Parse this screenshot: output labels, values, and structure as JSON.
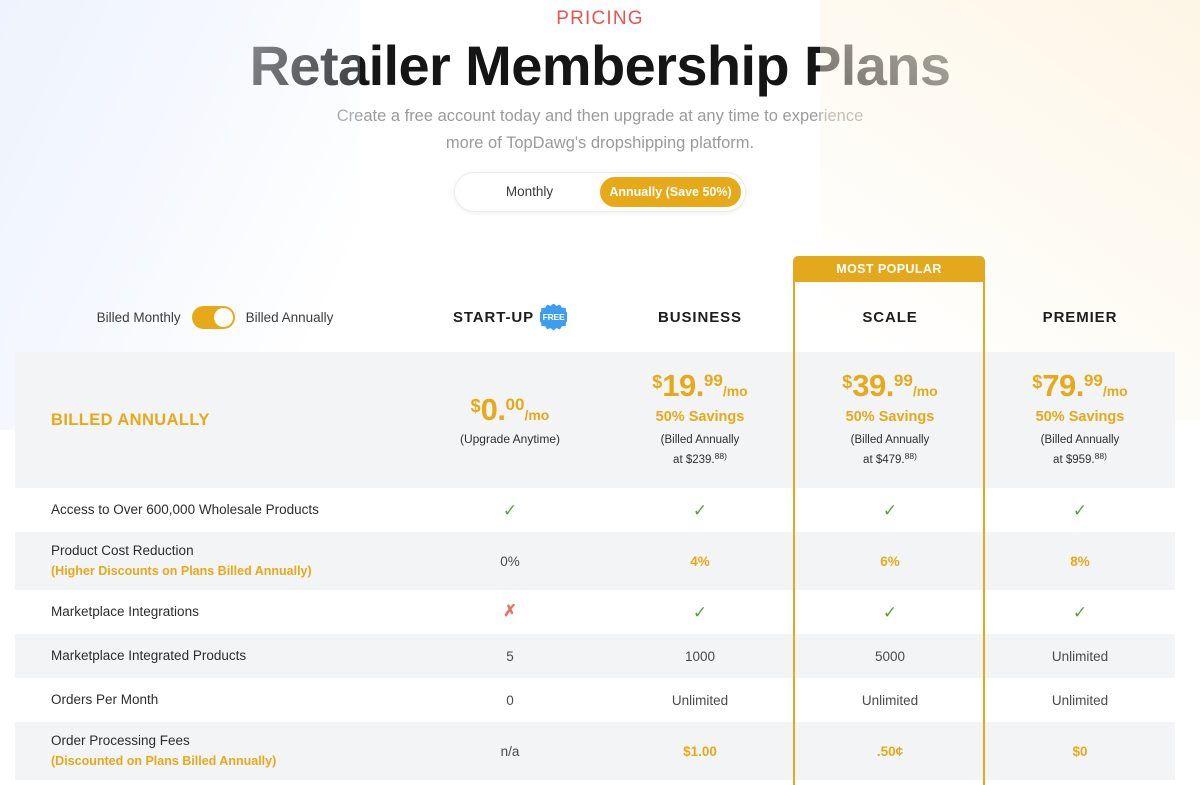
{
  "header": {
    "eyebrow": "PRICING",
    "title": "Retailer Membership Plans",
    "subtitle_line1": "Create a free account today and then upgrade at any time to experience",
    "subtitle_line2": "more of TopDawg's dropshipping platform."
  },
  "billing_period_toggle": {
    "monthly_label": "Monthly",
    "annual_label": "Annually (Save 50%)",
    "selected": "Annually (Save 50%)"
  },
  "table_billing_switch": {
    "left_label": "Billed Monthly",
    "right_label": "Billed Annually",
    "state": "annually"
  },
  "highlight": {
    "banner_label": "MOST POPULAR",
    "column": "SCALE"
  },
  "colors": {
    "accent_orange": "#E8A918",
    "banner_orange": "#E3A81B",
    "eyebrow_red": "#E8554E",
    "check_green": "#58A23A",
    "cross_red": "#E8706B",
    "free_badge_blue": "#3D9EF0",
    "row_alt_gray": "#F2F4F6"
  },
  "plans": [
    {
      "name": "START-UP",
      "badge": "FREE"
    },
    {
      "name": "BUSINESS",
      "badge": ""
    },
    {
      "name": "SCALE",
      "badge": ""
    },
    {
      "name": "PREMIER",
      "badge": ""
    }
  ],
  "price_row": {
    "label": "BILLED ANNUALLY",
    "cells": [
      {
        "currency": "$",
        "amount": "0.",
        "cents": "00",
        "per": "/mo",
        "note": "(Upgrade Anytime)",
        "savings": "",
        "billed_line1": "",
        "billed_line2": "",
        "billed_sup": ""
      },
      {
        "currency": "$",
        "amount": "19.",
        "cents": "99",
        "per": "/mo",
        "note": "",
        "savings": "50% Savings",
        "billed_line1": "(Billed Annually",
        "billed_line2": "at $239.",
        "billed_sup": "88)"
      },
      {
        "currency": "$",
        "amount": "39.",
        "cents": "99",
        "per": "/mo",
        "note": "",
        "savings": "50% Savings",
        "billed_line1": "(Billed Annually",
        "billed_line2": "at $479.",
        "billed_sup": "88)"
      },
      {
        "currency": "$",
        "amount": "79.",
        "cents": "99",
        "per": "/mo",
        "note": "",
        "savings": "50% Savings",
        "billed_line1": "(Billed Annually",
        "billed_line2": "at $959.",
        "billed_sup": "88)"
      }
    ]
  },
  "features": [
    {
      "label": "Access to Over 600,000 Wholesale Products",
      "sublabel": "",
      "values": [
        "check",
        "check",
        "check",
        "check"
      ]
    },
    {
      "label": "Product Cost Reduction",
      "sublabel": "(Higher Discounts on Plans Billed Annually)",
      "values": [
        "0%",
        "4%",
        "6%",
        "8%"
      ],
      "accents": [
        false,
        true,
        true,
        true
      ]
    },
    {
      "label": "Marketplace Integrations",
      "sublabel": "",
      "values": [
        "cross",
        "check",
        "check",
        "check"
      ]
    },
    {
      "label": "Marketplace Integrated Products",
      "sublabel": "",
      "values": [
        "5",
        "1000",
        "5000",
        "Unlimited"
      ],
      "accents": [
        false,
        false,
        false,
        false
      ]
    },
    {
      "label": "Orders Per Month",
      "sublabel": "",
      "values": [
        "0",
        "Unlimited",
        "Unlimited",
        "Unlimited"
      ],
      "accents": [
        false,
        false,
        false,
        false
      ]
    },
    {
      "label": "Order Processing Fees",
      "sublabel": "(Discounted on Plans Billed Annually)",
      "values": [
        "n/a",
        "$1.00",
        ".50¢",
        "$0"
      ],
      "accents": [
        false,
        true,
        true,
        true
      ]
    }
  ],
  "icons": {
    "check": "✓",
    "cross": "✗"
  }
}
